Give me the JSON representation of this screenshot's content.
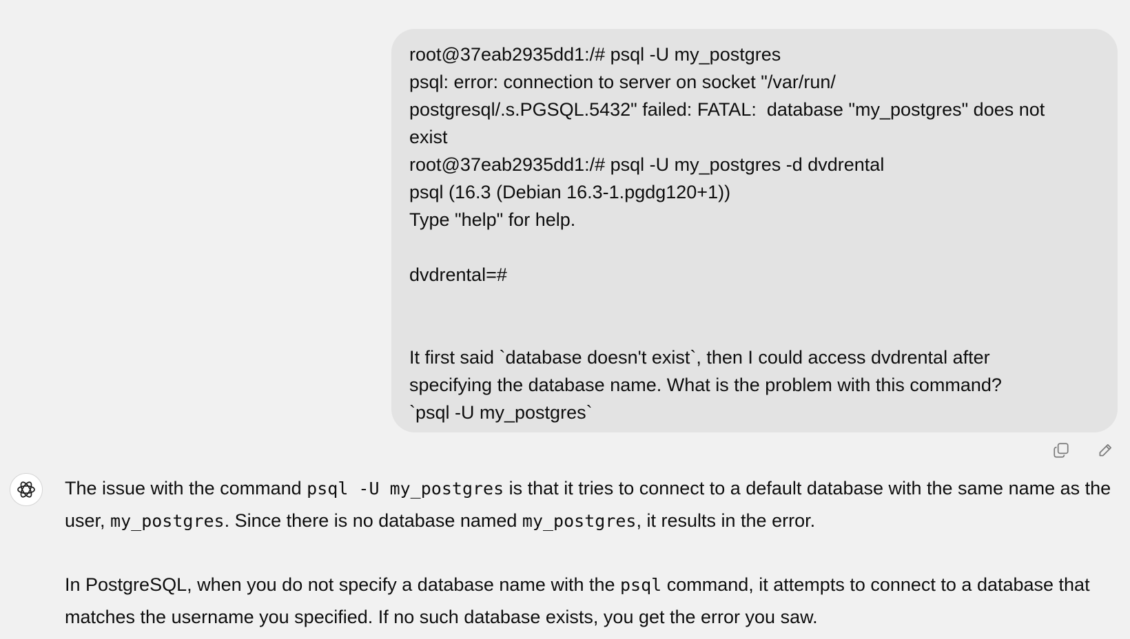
{
  "user_message": {
    "lines": [
      "root@37eab2935dd1:/# psql -U my_postgres",
      "psql: error: connection to server on socket \"/var/run/",
      "postgresql/.s.PGSQL.5432\" failed: FATAL:  database \"my_postgres\" does not",
      "exist",
      "root@37eab2935dd1:/# psql -U my_postgres -d dvdrental",
      "psql (16.3 (Debian 16.3-1.pgdg120+1))",
      "Type \"help\" for help.",
      "",
      "dvdrental=#",
      "",
      "",
      "It first said `database doesn't exist`, then I could access dvdrental after",
      "specifying the database name. What is the problem with this command?",
      "`psql -U my_postgres`"
    ]
  },
  "actions": {
    "copy_icon": "copy-icon",
    "edit_icon": "pencil-icon"
  },
  "assistant": {
    "avatar_icon": "openai-logo-icon",
    "p1": {
      "t1": "The issue with the command ",
      "c1": "psql -U my_postgres",
      "t2": " is that it tries to connect to a default database with the same name as the user, ",
      "c2": "my_postgres",
      "t3": ". Since there is no database named ",
      "c3": "my_postgres",
      "t4": ", it results in the error."
    },
    "p2": {
      "t1": "In PostgreSQL, when you do not specify a database name with the ",
      "c1": "psql",
      "t2": " command, it attempts to connect to a database that matches the username you specified. If no such database exists, you get the error you saw."
    }
  }
}
